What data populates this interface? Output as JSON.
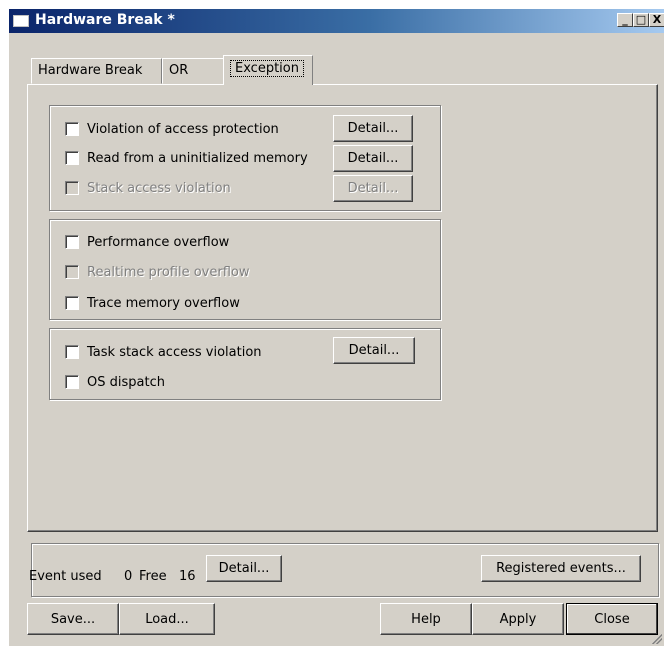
{
  "window": {
    "title": "Hardware Break *",
    "minimize_label": "_",
    "maximize_label": "□",
    "close_label": "X"
  },
  "tabs": [
    {
      "label": "Hardware Break",
      "active": false
    },
    {
      "label": "OR",
      "active": false
    },
    {
      "label": "Exception",
      "active": true
    }
  ],
  "groups": [
    {
      "items": [
        {
          "label": "Violation of access protection",
          "checked": false,
          "enabled": true,
          "detail": "Detail..."
        },
        {
          "label": "Read from a uninitialized memory",
          "checked": false,
          "enabled": true,
          "detail": "Detail..."
        },
        {
          "label": "Stack access violation",
          "checked": false,
          "enabled": false,
          "detail": "Detail..."
        }
      ]
    },
    {
      "items": [
        {
          "label": "Performance overflow",
          "checked": false,
          "enabled": true
        },
        {
          "label": "Realtime profile overflow",
          "checked": false,
          "enabled": false
        },
        {
          "label": "Trace memory overflow",
          "checked": false,
          "enabled": true
        }
      ]
    },
    {
      "items": [
        {
          "label": "Task stack access violation",
          "checked": false,
          "enabled": true,
          "detail": "Detail..."
        },
        {
          "label": "OS dispatch",
          "checked": false,
          "enabled": true
        }
      ]
    }
  ],
  "status": {
    "event_used_label": "Event used",
    "event_used_value": "0",
    "free_label": "Free",
    "free_value": "16",
    "detail_button": "Detail...",
    "registered_button": "Registered events..."
  },
  "footer": {
    "save": "Save...",
    "load": "Load...",
    "help": "Help",
    "apply": "Apply",
    "close": "Close"
  }
}
